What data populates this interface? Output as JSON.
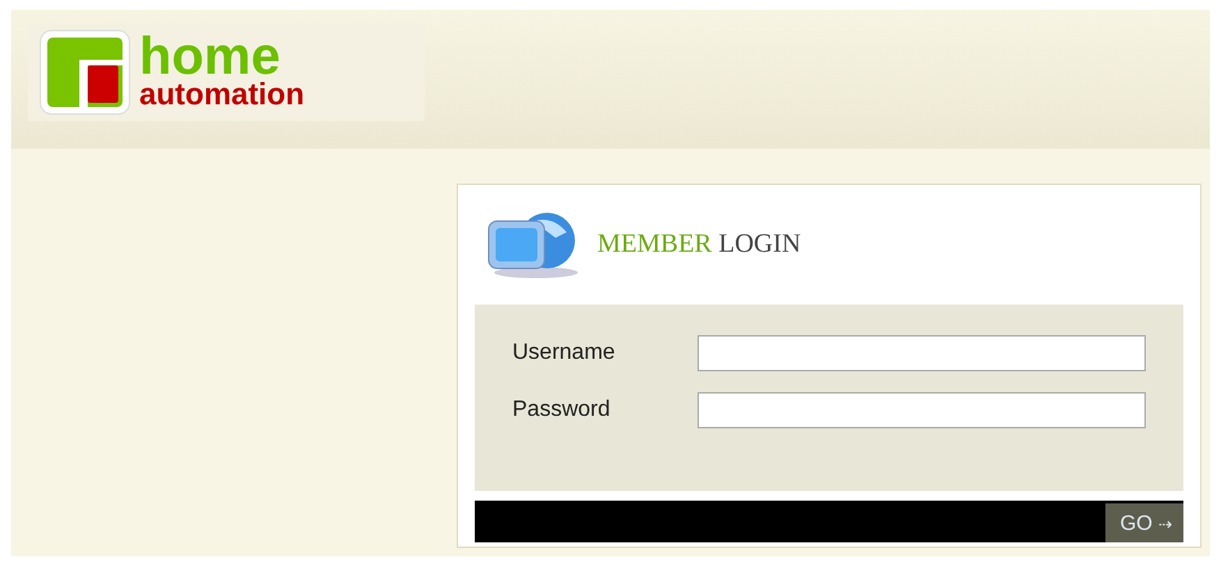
{
  "logo": {
    "line_1": "home",
    "line_2": "automation"
  },
  "login": {
    "title_accent": "MEMBER",
    "title_rest": "LOGIN",
    "fields": [
      {
        "label": "Username"
      },
      {
        "label": "Password"
      }
    ],
    "submit": {
      "label": "GO",
      "icon": "⇢"
    }
  }
}
